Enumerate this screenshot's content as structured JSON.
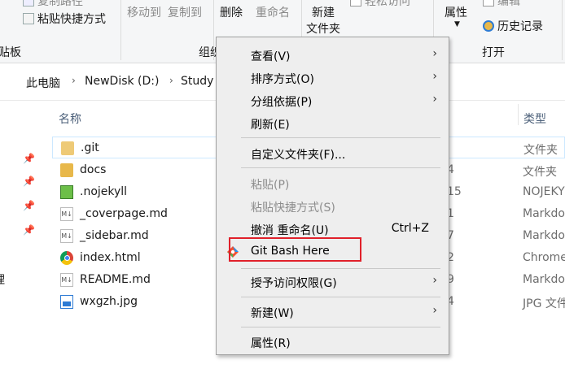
{
  "ribbon": {
    "copy_path": "复制路径",
    "paste_shortcut": "粘贴快捷方式",
    "clipboard_group": "贴板",
    "move_to": "移动到",
    "copy_to": "复制到",
    "delete": "删除",
    "rename": "重命名",
    "organize_group": "组织",
    "new_folder_line1": "新建",
    "new_folder_line2": "文件夹",
    "easy_access": "轻松访问",
    "properties": "属性",
    "edit": "编辑",
    "history": "历史记录",
    "open_group": "打开"
  },
  "address": {
    "crumbs": [
      "此电脑",
      "NewDisk (D:)",
      "Study"
    ]
  },
  "columns": {
    "name": "名称",
    "type": "类型"
  },
  "files": [
    {
      "name": ".git",
      "extra": "",
      "type": "文件夹",
      "icon": "folder-icon"
    },
    {
      "name": "docs",
      "extra": "4",
      "type": "文件夹",
      "icon": "folder-icon"
    },
    {
      "name": ".nojekyll",
      "extra": "15",
      "type": "NOJEKYLL",
      "icon": "notepad-icon"
    },
    {
      "name": "_coverpage.md",
      "extra": "1",
      "type": "Markdown",
      "icon": "markdown-icon"
    },
    {
      "name": "_sidebar.md",
      "extra": "7",
      "type": "Markdown",
      "icon": "markdown-icon"
    },
    {
      "name": "index.html",
      "extra": "2",
      "type": "Chrome",
      "icon": "chrome-icon"
    },
    {
      "name": "README.md",
      "extra": "9",
      "type": "Markdown",
      "icon": "markdown-icon"
    },
    {
      "name": "wxgzh.jpg",
      "extra": "4",
      "type": "JPG 文件",
      "icon": "image-icon"
    }
  ],
  "menu": {
    "view": "查看(V)",
    "sort": "排序方式(O)",
    "group": "分组依据(P)",
    "refresh": "刷新(E)",
    "customize": "自定义文件夹(F)...",
    "paste": "粘贴(P)",
    "paste_shortcut": "粘贴快捷方式(S)",
    "undo_rename": "撤消 重命名(U)",
    "undo_shortcut": "Ctrl+Z",
    "git_bash": "Git Bash Here",
    "give_access": "授予访问权限(G)",
    "new": "新建(W)",
    "properties": "属性(R)"
  },
  "colors": {
    "highlight_border": "#e0202a",
    "folder": "#e8b84a",
    "menu_bg": "#eeeeee"
  }
}
